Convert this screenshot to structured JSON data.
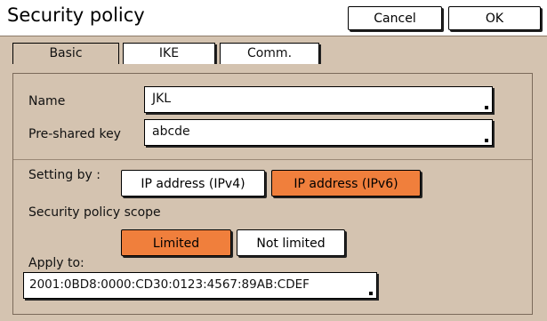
{
  "window": {
    "title": "Security policy",
    "cancel_label": "Cancel",
    "ok_label": "OK"
  },
  "tabs": [
    {
      "label": "Basic",
      "active": true
    },
    {
      "label": "IKE",
      "active": false
    },
    {
      "label": "Comm.",
      "active": false
    }
  ],
  "form": {
    "name_label": "Name",
    "name_value": "JKL",
    "psk_label": "Pre-shared key",
    "psk_value": "abcde",
    "setting_by_label": "Setting by :",
    "setting_options": [
      {
        "label": "IP address (IPv4)",
        "selected": false
      },
      {
        "label": "IP address (IPv6)",
        "selected": true
      }
    ],
    "scope_label": "Security policy scope",
    "scope_options": [
      {
        "label": "Limited",
        "selected": true
      },
      {
        "label": "Not limited",
        "selected": false
      }
    ],
    "apply_to_label": "Apply to:",
    "apply_to_value": "2001:0BD8:0000:CD30:0123:4567:89AB:CDEF"
  },
  "colors": {
    "panel_bg": "#d4c3b0",
    "selected_bg": "#f07f3c",
    "border": "#000000"
  }
}
